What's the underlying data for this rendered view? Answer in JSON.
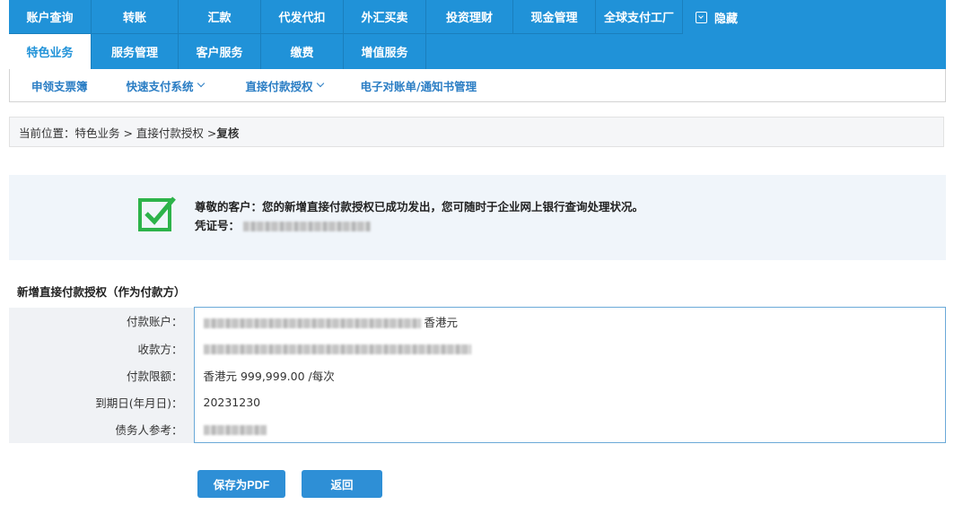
{
  "nav": {
    "row1": [
      "账户查询",
      "转账",
      "汇款",
      "代发代扣",
      "外汇买卖",
      "投资理财",
      "现金管理",
      "全球支付工厂"
    ],
    "hide_label": "隐藏",
    "row2": [
      "特色业务",
      "服务管理",
      "客户服务",
      "缴费",
      "增值服务"
    ]
  },
  "subnav": {
    "items": [
      "申领支票簿",
      "快速支付系统",
      "直接付款授权",
      "电子对账单/通知书管理"
    ]
  },
  "breadcrumb": {
    "prefix": "当前位置：特色业务 > 直接付款授权 > ",
    "current": "复核"
  },
  "notice": {
    "message": "尊敬的客户：您的新增直接付款授权已成功发出，您可随时于企业网上银行查询处理状况。",
    "voucher_label": "凭证号："
  },
  "section_title": "新增直接付款授权（作为付款方）",
  "details": {
    "payer_account_label": "付款账户：",
    "payer_currency": "香港元",
    "payee_label": "收款方：",
    "limit_label": "付款限额：",
    "limit_value": "香港元 999,999.00 /每次",
    "expiry_label": "到期日(年月日)：",
    "expiry_value": "20231230",
    "debtor_ref_label": "债务人参考："
  },
  "buttons": {
    "save_pdf": "保存为PDF",
    "back": "返回"
  },
  "colors": {
    "nav_blue": "#2092d8",
    "link_blue": "#2a7dc4",
    "success_green": "#2db34a"
  }
}
